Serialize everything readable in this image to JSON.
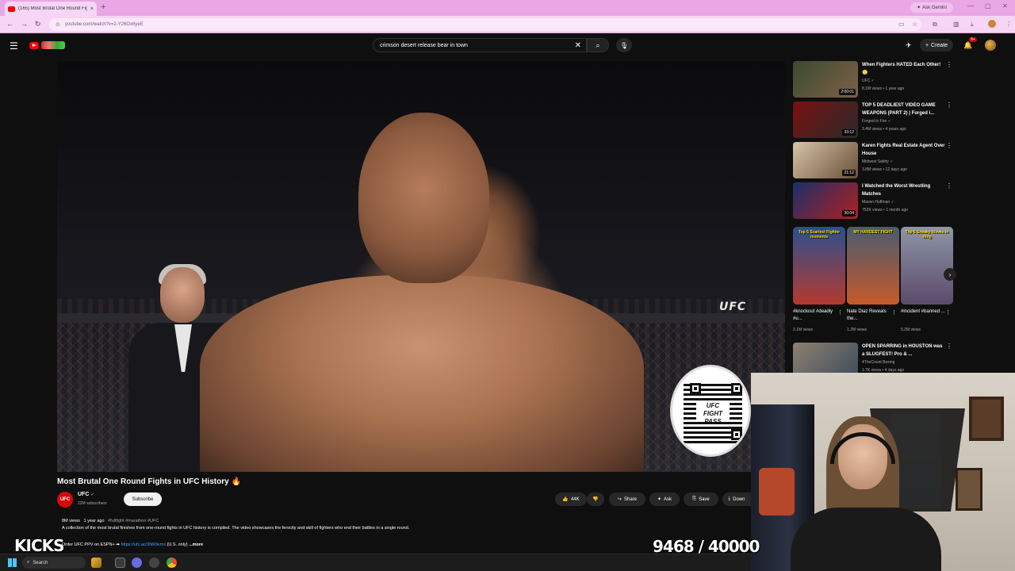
{
  "browser": {
    "tab_title": "(165) Most Brutal One Round Fights",
    "tab_close": "×",
    "new_tab": "+",
    "ask_gemini": "Ask Gemini",
    "url": "youtube.com/watch?v=2-Y26Ox6yeE",
    "nav": {
      "back": "←",
      "forward": "→",
      "reload": "↻"
    }
  },
  "youtube": {
    "search_query": "crimson desert release bear in town",
    "create_label": "Create",
    "notification_count": "9+"
  },
  "video": {
    "title": "Most Brutal One Round Fights in UFC History 🔥",
    "watermark": "UFC",
    "qr_label": "UFC FIGHT PASS",
    "channel": {
      "avatar_text": "UFC",
      "name": "UFC",
      "verified": "✓",
      "subscribers": "22M subscribers",
      "subscribe_label": "Subscribe"
    },
    "actions": {
      "likes": "44K",
      "share": "Share",
      "ask": "Ask",
      "save": "Save",
      "download": "Down"
    },
    "description": {
      "views": "8M views",
      "age": "1 year ago",
      "tags": "#fullfight #marathon #UFC",
      "text": "A collection of the most brutal finishes from one-round fights in UFC history is compiled. The video showcases the ferocity and skill of fighters who end their battles in a single round.",
      "promo_prefix": "Order UFC PPV on ESPN+ ➡",
      "link": "https://ufc.ac/3NK9vmx",
      "promo_suffix": "(U.S. only)",
      "more": "...more"
    }
  },
  "overlays": {
    "kicks": "KICKS",
    "counter": "9468 / 40000"
  },
  "recommendations": [
    {
      "title": "When Fighters HATED Each Other! 😳",
      "channel": "UFC ✓",
      "meta": "8.1M views • 1 year ago",
      "duration": "2:00:01",
      "colors": [
        "#3b4a2f",
        "#7d6148"
      ]
    },
    {
      "title": "TOP 5 DEADLIEST VIDEO GAME WEAPONS (PART 2) | Forged i...",
      "channel": "Forged in Fire ✓",
      "meta": "3.4M views • 4 years ago",
      "duration": "33:12",
      "colors": [
        "#7a1010",
        "#2a2a2a"
      ]
    },
    {
      "title": "Karen Fights Real Estate Agent Over House",
      "channel": "Midwest Safety ✓",
      "meta": "3.8M views • 12 days ago",
      "duration": "21:12",
      "colors": [
        "#d7c4a5",
        "#6a4f3a"
      ]
    },
    {
      "title": "I Watched the Worst Wrestling Matches",
      "channel": "Maven Huffman ✓",
      "meta": "752K views • 1 month ago",
      "duration": "30:04",
      "colors": [
        "#1b2f6b",
        "#b0201f"
      ]
    },
    {
      "title": "OPEN SPARRING in HOUSTON was a SLUGFEST! Pro & ...",
      "channel": "4TheCount Boxing",
      "meta": "1.7K views • 4 days ago",
      "duration": "",
      "colors": [
        "#8d8070",
        "#3e4c5c"
      ]
    }
  ],
  "shorts": [
    {
      "caption": "Top 5 Scariest Fighter moments",
      "title": "#knockout #deadly #u...",
      "views": "2.1M views",
      "colors": [
        "#2c4f8f",
        "#b33a2e"
      ]
    },
    {
      "caption": "MY HARDEST FIGHT",
      "title": "Nate Diaz Reveals the...",
      "views": "1.2M views",
      "colors": [
        "#4a5b6f",
        "#c55a2a"
      ]
    },
    {
      "caption": "Top 5 Sneaky Moves in Ring",
      "title": "#incident #banned ...",
      "views": "5.2M views",
      "colors": [
        "#8e95a8",
        "#5b4a6a"
      ]
    }
  ],
  "taskbar": {
    "search_label": "Search"
  }
}
